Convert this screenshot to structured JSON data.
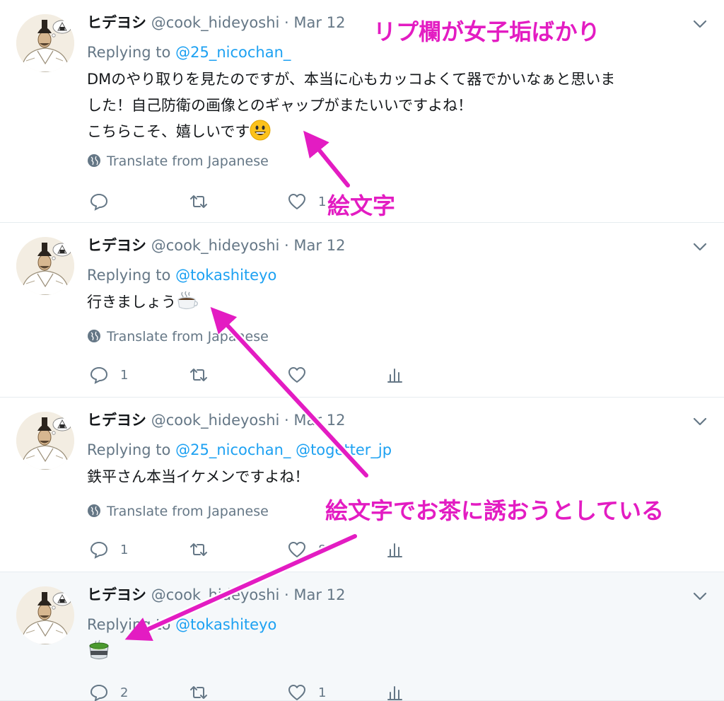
{
  "colors": {
    "accent": "#1da1f2",
    "annotation": "#e31cc2",
    "muted": "#657786"
  },
  "tweets": [
    {
      "name": "ヒデヨシ",
      "handle": "@cook_hideyoshi",
      "dot": "·",
      "date": "Mar 12",
      "replying_label": "Replying to",
      "mentions": [
        "@25_nicochan_"
      ],
      "body": [
        "DMのやり取りを見たのですが、本当に心もカッコよくて器でかいなぁと思いま",
        "した！自己防衛の画像とのギャップがまたいいですよね！",
        "こちらこそ、嬉しいです"
      ],
      "translate": "Translate from Japanese",
      "counts": {
        "reply": "",
        "retweet": "",
        "like": "1"
      }
    },
    {
      "name": "ヒデヨシ",
      "handle": "@cook_hideyoshi",
      "dot": "·",
      "date": "Mar 12",
      "replying_label": "Replying to",
      "mentions": [
        "@tokashiteyo"
      ],
      "body": [
        "行きましょう"
      ],
      "translate": "Translate from Japanese",
      "counts": {
        "reply": "1",
        "retweet": "",
        "like": ""
      }
    },
    {
      "name": "ヒデヨシ",
      "handle": "@cook_hideyoshi",
      "dot": "·",
      "date": "Mar 12",
      "replying_label": "Replying to",
      "mentions": [
        "@25_nicochan_",
        "@togetter_jp"
      ],
      "body": [
        "鉄平さん本当イケメンですよね！"
      ],
      "translate": "Translate from Japanese",
      "counts": {
        "reply": "1",
        "retweet": "",
        "like": "8"
      }
    },
    {
      "name": "ヒデヨシ",
      "handle": "@cook_hideyoshi",
      "dot": "·",
      "date": "Mar 12",
      "replying_label": "Replying to",
      "mentions": [
        "@tokashiteyo"
      ],
      "body": [
        ""
      ],
      "translate": "",
      "counts": {
        "reply": "2",
        "retweet": "",
        "like": "1"
      }
    }
  ],
  "emojis": {
    "t0": "smiling-face-emoji",
    "t1": "hot-beverage-emoji",
    "t3": "green-tea-emoji"
  },
  "annotations": {
    "top": "リプ欄が女子垢ばかり",
    "emoji": "絵文字",
    "tea": "絵文字でお茶に誘おうとしている"
  }
}
